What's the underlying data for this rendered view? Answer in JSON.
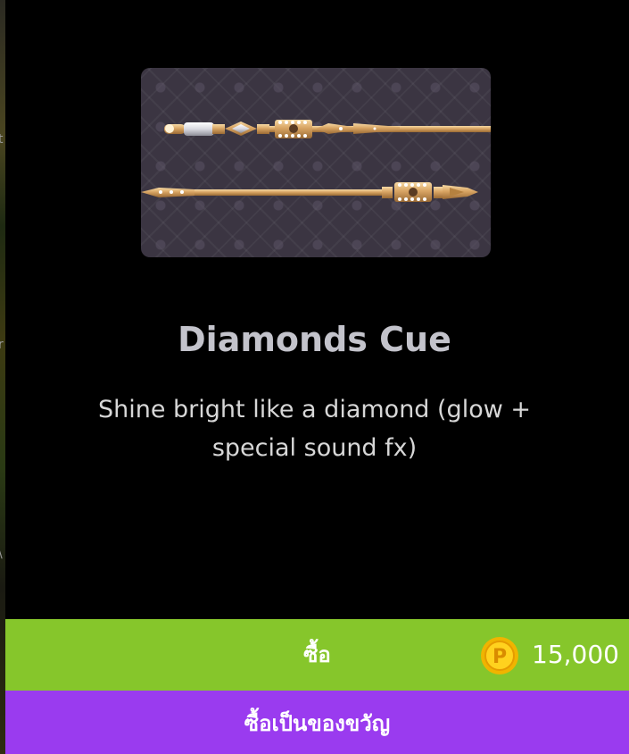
{
  "item": {
    "image_name": "diamonds-cue-image",
    "title": "Diamonds Cue",
    "description": "Shine bright like a diamond (glow + special sound fx)"
  },
  "buy": {
    "label": "ซื้อ",
    "price": "15,000",
    "currency_icon": "p-coin-icon",
    "color": "#86c62b"
  },
  "gift": {
    "label": "ซื้อเป็นของขวัญ",
    "color": "#9a3bef"
  }
}
